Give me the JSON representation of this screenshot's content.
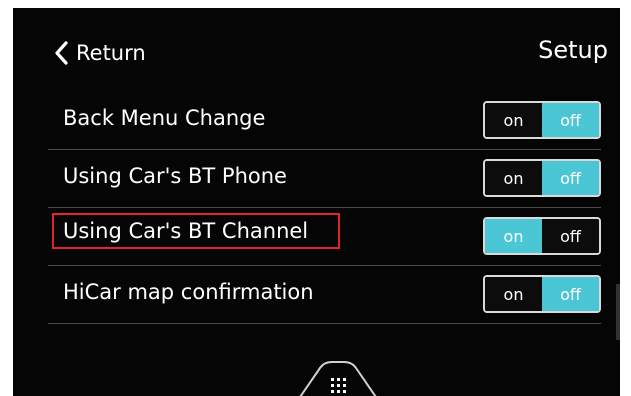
{
  "header": {
    "return_label": "Return",
    "title": "Setup"
  },
  "settings": [
    {
      "label": "Back Menu Change",
      "on_label": "on",
      "off_label": "off",
      "state": "off"
    },
    {
      "label": "Using Car's BT Phone",
      "on_label": "on",
      "off_label": "off",
      "state": "off"
    },
    {
      "label": "Using Car's BT Channel",
      "on_label": "on",
      "off_label": "off",
      "state": "on",
      "highlighted": true
    },
    {
      "label": "HiCar map confirmation",
      "on_label": "on",
      "off_label": "off",
      "state": "off"
    }
  ],
  "colors": {
    "accent": "#4ac6d4",
    "highlight_border": "#e0242a",
    "background": "#050505"
  },
  "icons": {
    "back": "chevron-left-icon",
    "home": "grid-dots-icon"
  }
}
